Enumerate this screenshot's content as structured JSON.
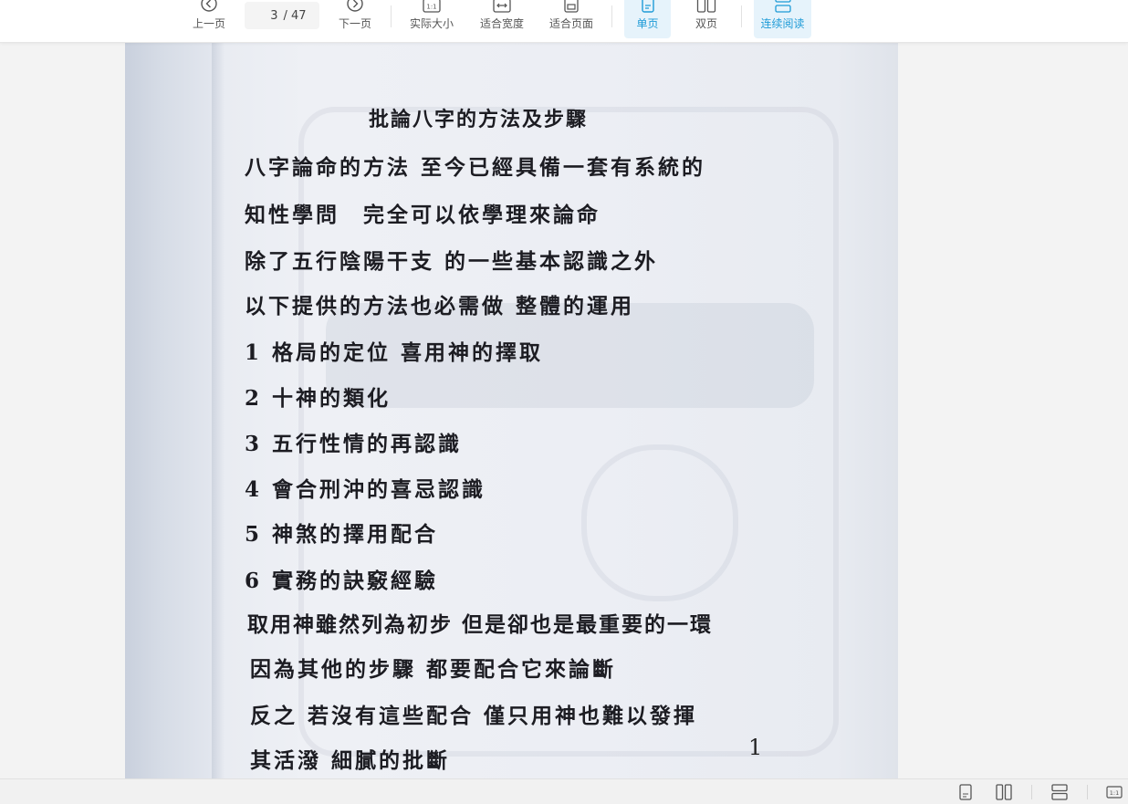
{
  "toolbar": {
    "prev_label": "上一页",
    "current_page": "3",
    "page_separator": "/ 47",
    "next_label": "下一页",
    "actual_size_label": "实际大小",
    "fit_width_label": "适合宽度",
    "fit_page_label": "适合页面",
    "single_page_label": "单页",
    "double_page_label": "双页",
    "continuous_label": "连续阅读",
    "accent_color": "#1e9bd7"
  },
  "document": {
    "title": "批論八字的方法及步驟",
    "lines": [
      "八字論命的方法 至今已經具備一套有系統的",
      "知性學問　完全可以依學理來論命",
      "除了五行陰陽干支 的一些基本認識之外",
      "以下提供的方法也必需做 整體的運用",
      "1 格局的定位 喜用神的擇取",
      "2 十神的類化",
      "3 五行性情的再認識",
      "4 會合刑沖的喜忌認識",
      "5 神煞的擇用配合",
      "6 實務的訣竅經驗",
      "取用神雖然列為初步 但是卻也是最重要的一環",
      "因為其他的步驟 都要配合它來論斷",
      "反之 若沒有這些配合 僅只用神也難以發揮",
      "其活潑 細膩的批斷"
    ],
    "page_number": "1"
  },
  "statusbar": {
    "icons": [
      "single-page-icon",
      "double-page-icon",
      "continuous-icon",
      "actual-size-icon"
    ]
  }
}
